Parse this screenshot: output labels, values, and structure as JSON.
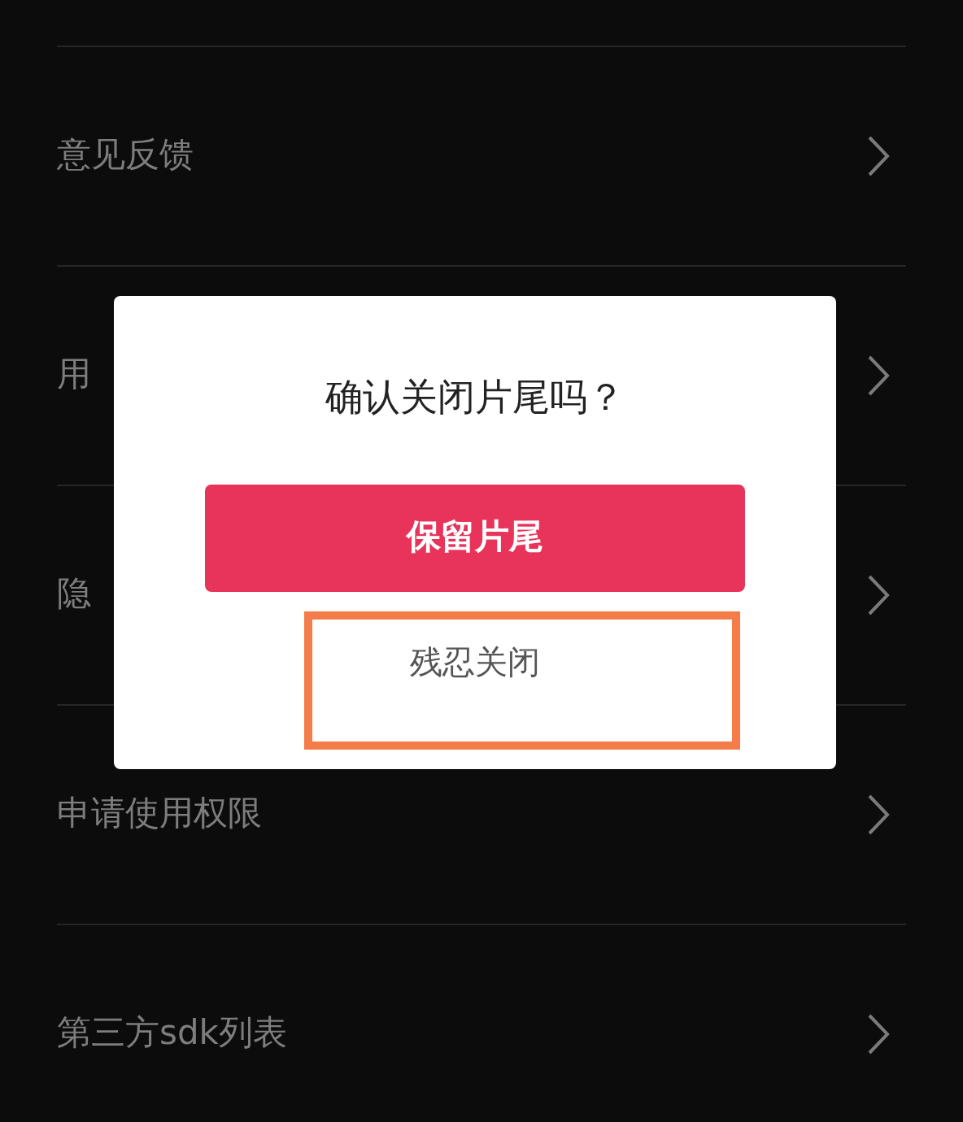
{
  "settings_list": [
    {
      "label": "意见反馈"
    },
    {
      "label": "用"
    },
    {
      "label": "隐"
    },
    {
      "label": "申请使用权限"
    },
    {
      "label": "第三方sdk列表"
    }
  ],
  "dialog": {
    "title": "确认关闭片尾吗？",
    "buttons": [
      {
        "kind": "primary",
        "label": "保留片尾",
        "highlighted": false
      },
      {
        "kind": "secondary",
        "label": "残忍关闭",
        "highlighted": true
      }
    ]
  }
}
